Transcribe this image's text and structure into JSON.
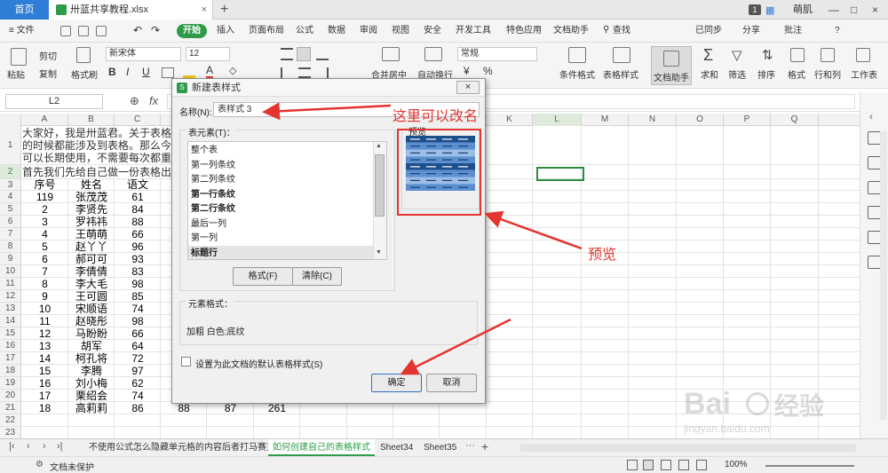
{
  "titlebar": {
    "home_tab": "首页",
    "file_tab": "卅蓝共享教程.xlsx",
    "file_close": "×",
    "new_tab": "+",
    "badge": "1",
    "user": "萌肌",
    "win_min": "—",
    "win_max": "□",
    "win_close": "×"
  },
  "menu": {
    "file": "≡ 文件",
    "start": "开始",
    "items": [
      "插入",
      "页面布局",
      "公式",
      "数据",
      "审阅",
      "视图",
      "安全",
      "开发工具",
      "特色应用",
      "文档助手",
      "查找"
    ],
    "right": [
      "已同步",
      "分享",
      "批注",
      "?"
    ]
  },
  "toolbar": {
    "paste": "粘贴",
    "cut": "剪切",
    "copy": "复制",
    "format_painter": "格式刷",
    "font_name": "新宋体",
    "font_size": "12",
    "bold": "B",
    "italic": "I",
    "underline": "U",
    "merge_center": "合并居中",
    "wrap": "自动换行",
    "number_format": "常规",
    "percent": "%",
    "cond_format": "条件格式",
    "table_style": "表格样式",
    "doc_assistant": "文档助手",
    "sum": "求和",
    "filter": "筛选",
    "sort": "排序",
    "format": "格式",
    "row_col": "行和列",
    "worksheet": "工作表"
  },
  "formula_bar": {
    "name_box": "L2",
    "fx": "fx"
  },
  "sheet": {
    "columns": [
      "A",
      "B",
      "C",
      "D",
      "E",
      "F",
      "G",
      "H",
      "I",
      "J",
      "K",
      "L",
      "M",
      "N",
      "O",
      "P",
      "Q"
    ],
    "row_numbers": [
      "1",
      "2",
      "3",
      "4",
      "5",
      "6",
      "7",
      "8",
      "9",
      "10",
      "11",
      "12",
      "13",
      "14",
      "15",
      "16",
      "17",
      "18",
      "19",
      "20",
      "21",
      "22",
      "23"
    ],
    "intro_lines": [
      "大家好，我是卅蓝君。关于表格的",
      "的时候都能涉及到表格。那么今",
      "可以长期使用，不需要每次都重"
    ],
    "row2_text": "首先我们先给自己做一份表格出",
    "headers": [
      "序号",
      "姓名",
      "语文"
    ],
    "rows": [
      [
        "119",
        "张茂茂",
        "61"
      ],
      [
        "2",
        "李贤先",
        "84"
      ],
      [
        "3",
        "罗祎祎",
        "88"
      ],
      [
        "4",
        "王萌萌",
        "66"
      ],
      [
        "5",
        "赵丫丫",
        "96"
      ],
      [
        "6",
        "郝可可",
        "93"
      ],
      [
        "7",
        "李倩倩",
        "83"
      ],
      [
        "8",
        "李大毛",
        "98"
      ],
      [
        "9",
        "王可圆",
        "85"
      ],
      [
        "10",
        "宋顺语",
        "74"
      ],
      [
        "11",
        "赵晓彤",
        "98"
      ],
      [
        "12",
        "马盼盼",
        "66"
      ],
      [
        "13",
        "胡军",
        "64"
      ],
      [
        "14",
        "柯孔将",
        "72"
      ],
      [
        "15",
        "李腾",
        "97"
      ],
      [
        "16",
        "刘小梅",
        "62"
      ],
      [
        "17",
        "栗绍会",
        "74"
      ],
      [
        "18",
        "高莉莉",
        "86",
        "88",
        "87",
        "261"
      ]
    ]
  },
  "sheet_tabs": {
    "tabs": [
      "不使用公式怎么隐藏单元格的内容后者打马赛克",
      "如何创建自己的表格样式",
      "Sheet34",
      "Sheet35"
    ],
    "active_index": 1,
    "add": "+"
  },
  "status": {
    "protect": "文档未保护",
    "zoom": "100%"
  },
  "dialog": {
    "title": "新建表样式",
    "close": "×",
    "name_label": "名称(N):",
    "name_value": "表样式 3",
    "elements_label": "表元素(T)：",
    "elements": [
      "整个表",
      "第一列条纹",
      "第二列条纹",
      "第一行条纹",
      "第二行条纹",
      "最后一列",
      "第一列",
      "标题行"
    ],
    "bold_elements": [
      3,
      4,
      7
    ],
    "selected_index": 7,
    "format_btn": "格式(F)",
    "clear_btn": "清除(C)",
    "preview_label": "预览",
    "elem_format_label": "元素格式：",
    "elem_format_value": "加粗 白色;底纹",
    "default_checkbox": "设置为此文档的默认表格样式(S)",
    "ok": "确定",
    "cancel": "取消"
  },
  "annotations": {
    "rename_note": "这里可以改名",
    "preview_note": "预览"
  },
  "watermark": {
    "brand": "Bai",
    "suffix": "经验",
    "url": "jingyan.baidu.com"
  }
}
